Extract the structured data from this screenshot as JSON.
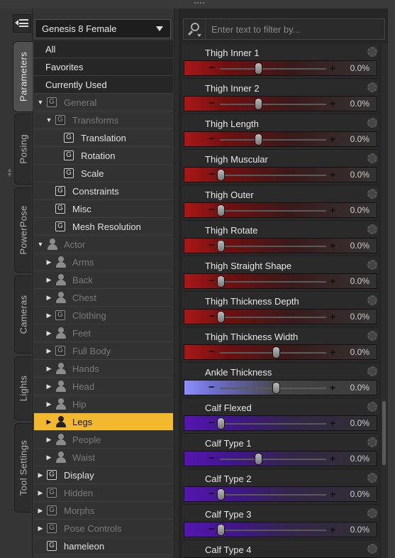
{
  "figure_selector": {
    "value": "Genesis 8 Female"
  },
  "side_tabs": [
    {
      "label": "Parameters",
      "active": true
    },
    {
      "label": "Posing",
      "active": false
    },
    {
      "label": "PowerPose",
      "active": false
    },
    {
      "label": "Cameras",
      "active": false
    },
    {
      "label": "Lights",
      "active": false
    },
    {
      "label": "Tool Settings",
      "active": false
    }
  ],
  "tree": [
    {
      "label": "All",
      "kind": "top",
      "indent": 0,
      "icon": "none",
      "expander": "none",
      "dim": false,
      "selected": false
    },
    {
      "label": "Favorites",
      "kind": "top",
      "indent": 0,
      "icon": "none",
      "expander": "none",
      "dim": false,
      "selected": false
    },
    {
      "label": "Currently Used",
      "kind": "top",
      "indent": 0,
      "icon": "none",
      "expander": "none",
      "dim": false,
      "selected": false
    },
    {
      "label": "General",
      "indent": 0,
      "icon": "group",
      "expander": "open",
      "dim": true,
      "selected": false
    },
    {
      "label": "Transforms",
      "indent": 1,
      "icon": "group",
      "expander": "open",
      "dim": true,
      "selected": false
    },
    {
      "label": "Translation",
      "indent": 2,
      "icon": "group",
      "expander": "none",
      "dim": false,
      "selected": false
    },
    {
      "label": "Rotation",
      "indent": 2,
      "icon": "group",
      "expander": "none",
      "dim": false,
      "selected": false
    },
    {
      "label": "Scale",
      "indent": 2,
      "icon": "group",
      "expander": "none",
      "dim": false,
      "selected": false
    },
    {
      "label": "Constraints",
      "indent": 1,
      "icon": "group",
      "expander": "none",
      "dim": false,
      "selected": false
    },
    {
      "label": "Misc",
      "indent": 1,
      "icon": "group",
      "expander": "none",
      "dim": false,
      "selected": false
    },
    {
      "label": "Mesh Resolution",
      "indent": 1,
      "icon": "group",
      "expander": "none",
      "dim": false,
      "selected": false
    },
    {
      "label": "Actor",
      "indent": 0,
      "icon": "person",
      "expander": "open",
      "dim": true,
      "selected": false
    },
    {
      "label": "Arms",
      "indent": 1,
      "icon": "person",
      "expander": "closed",
      "dim": true,
      "selected": false
    },
    {
      "label": "Back",
      "indent": 1,
      "icon": "person",
      "expander": "closed",
      "dim": true,
      "selected": false
    },
    {
      "label": "Chest",
      "indent": 1,
      "icon": "person",
      "expander": "closed",
      "dim": true,
      "selected": false
    },
    {
      "label": "Clothing",
      "indent": 1,
      "icon": "group",
      "expander": "closed",
      "dim": true,
      "selected": false
    },
    {
      "label": "Feet",
      "indent": 1,
      "icon": "person",
      "expander": "closed",
      "dim": true,
      "selected": false
    },
    {
      "label": "Full Body",
      "indent": 1,
      "icon": "group",
      "expander": "closed",
      "dim": true,
      "selected": false
    },
    {
      "label": "Hands",
      "indent": 1,
      "icon": "person",
      "expander": "closed",
      "dim": true,
      "selected": false
    },
    {
      "label": "Head",
      "indent": 1,
      "icon": "person",
      "expander": "closed",
      "dim": true,
      "selected": false
    },
    {
      "label": "Hip",
      "indent": 1,
      "icon": "person",
      "expander": "closed",
      "dim": true,
      "selected": false
    },
    {
      "label": "Legs",
      "indent": 1,
      "icon": "person",
      "expander": "closed",
      "dim": false,
      "selected": true
    },
    {
      "label": "People",
      "indent": 1,
      "icon": "person",
      "expander": "closed",
      "dim": true,
      "selected": false
    },
    {
      "label": "Waist",
      "indent": 1,
      "icon": "person",
      "expander": "closed",
      "dim": true,
      "selected": false
    },
    {
      "label": "Display",
      "indent": 0,
      "icon": "group",
      "expander": "closed",
      "dim": false,
      "selected": false
    },
    {
      "label": "Hidden",
      "indent": 0,
      "icon": "group",
      "expander": "closed",
      "dim": true,
      "selected": false
    },
    {
      "label": "Morphs",
      "indent": 0,
      "icon": "group",
      "expander": "closed",
      "dim": true,
      "selected": false
    },
    {
      "label": "Pose Controls",
      "indent": 0,
      "icon": "group",
      "expander": "closed",
      "dim": true,
      "selected": false
    },
    {
      "label": "hameleon",
      "indent": 0,
      "icon": "group",
      "expander": "none",
      "dim": false,
      "selected": false
    }
  ],
  "filter": {
    "placeholder": "Enter text to filter by..."
  },
  "colors": {
    "red": "#8e1414",
    "blue": "#8c8cff",
    "purple": "#4f1aa0",
    "selected": "#f2b82e"
  },
  "parameters": [
    {
      "name": "Thigh Inner 1",
      "value": "0.0%",
      "position": 0.35,
      "color": "red"
    },
    {
      "name": "Thigh Inner 2",
      "value": "0.0%",
      "position": 0.35,
      "color": "red"
    },
    {
      "name": "Thigh Length",
      "value": "0.0%",
      "position": 0.35,
      "color": "red"
    },
    {
      "name": "Thigh Muscular",
      "value": "0.0%",
      "position": 0.0,
      "color": "red"
    },
    {
      "name": "Thigh Outer",
      "value": "0.0%",
      "position": 0.0,
      "color": "red"
    },
    {
      "name": "Thigh Rotate",
      "value": "0.0%",
      "position": 0.0,
      "color": "red"
    },
    {
      "name": "Thigh Straight Shape",
      "value": "0.0%",
      "position": 0.0,
      "color": "red"
    },
    {
      "name": "Thigh Thickness Depth",
      "value": "0.0%",
      "position": 0.0,
      "color": "red"
    },
    {
      "name": "Thigh Thickness Width",
      "value": "0.0%",
      "position": 0.52,
      "color": "red"
    },
    {
      "name": "Ankle Thickness",
      "value": "0.0%",
      "position": 0.52,
      "color": "blue"
    },
    {
      "name": "Calf Flexed",
      "value": "0.0%",
      "position": 0.0,
      "color": "purple"
    },
    {
      "name": "Calf Type 1",
      "value": "0.0%",
      "position": 0.35,
      "color": "purple"
    },
    {
      "name": "Calf Type 2",
      "value": "0.0%",
      "position": 0.0,
      "color": "purple"
    },
    {
      "name": "Calf Type 3",
      "value": "0.0%",
      "position": 0.0,
      "color": "purple"
    },
    {
      "name": "Calf Type 4",
      "value": "",
      "position": 0.0,
      "color": "purple"
    }
  ]
}
